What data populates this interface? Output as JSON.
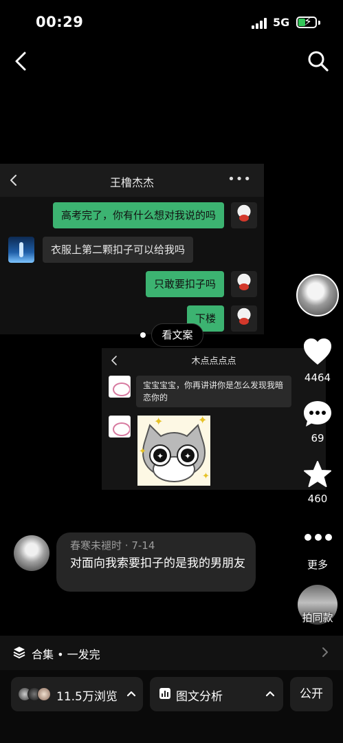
{
  "status_bar": {
    "time": "00:29",
    "network": "5G"
  },
  "post": {
    "screenshot1": {
      "title": "王橹杰杰",
      "more": "•••",
      "messages": [
        {
          "side": "right",
          "text": "高考完了，你有什么想对我说的吗"
        },
        {
          "side": "left",
          "text": "衣服上第二颗扣子可以给我吗"
        },
        {
          "side": "right",
          "text": "只敢要扣子吗"
        },
        {
          "side": "right",
          "text": "下楼"
        }
      ]
    },
    "see_text_label": "看文案",
    "screenshot2": {
      "title": "木点点点点",
      "message": "宝宝宝宝，你再讲讲你是怎么发现我暗恋你的"
    }
  },
  "actions": {
    "likes": "4464",
    "comments": "69",
    "favorites": "460",
    "more_label": "更多",
    "same_style_label": "拍同款"
  },
  "comment": {
    "author": "春寒未褪时",
    "date": "· 7-14",
    "text": "对面向我索要扣子的是我的男朋友"
  },
  "collection": {
    "label": "合集 • 一发完"
  },
  "bottom": {
    "views": "11.5万浏览",
    "analysis": "图文分析",
    "visibility": "公开"
  },
  "colors": {
    "accent_green": "#3cb371",
    "background": "#000000",
    "bubble": "#262626"
  }
}
